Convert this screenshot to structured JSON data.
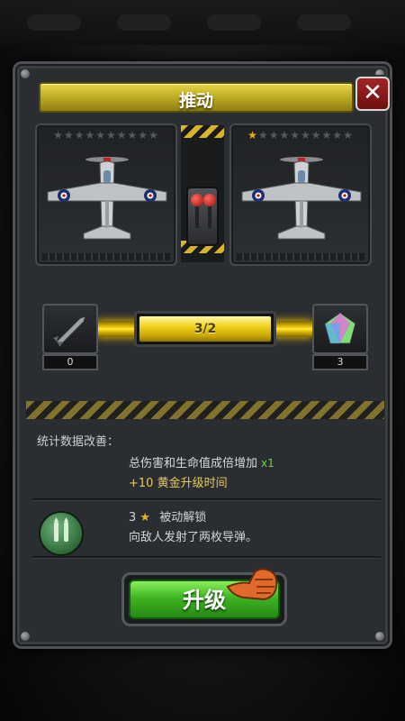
{
  "dialog": {
    "title": "推动",
    "close_symbol": "✕"
  },
  "cards": {
    "current": {
      "stars_total": 10,
      "stars_filled": 0
    },
    "next": {
      "stars_total": 10,
      "stars_filled": 1
    }
  },
  "progress": {
    "label": "3/2",
    "fill_fraction": 1.0,
    "left_count": "0",
    "right_count": "3"
  },
  "stats": {
    "header": "统计数据改善：",
    "line1": "总伤害和生命值成倍增加",
    "line1_mult": "x1",
    "line2": "+10 黄金升级时间"
  },
  "skill": {
    "star_level": "3",
    "unlock_label": "被动解锁",
    "description": "向敌人发射了两枚导弹。"
  },
  "upgrade": {
    "label": "升级"
  },
  "colors": {
    "title_gold": "#d8c636",
    "button_green": "#3fb422",
    "close_red": "#a52424",
    "star_gold": "#e6b41a"
  },
  "icons": [
    "close-icon",
    "star-icon",
    "missile-icon",
    "gem-icon",
    "pointer-hand-icon",
    "plane-icon"
  ]
}
